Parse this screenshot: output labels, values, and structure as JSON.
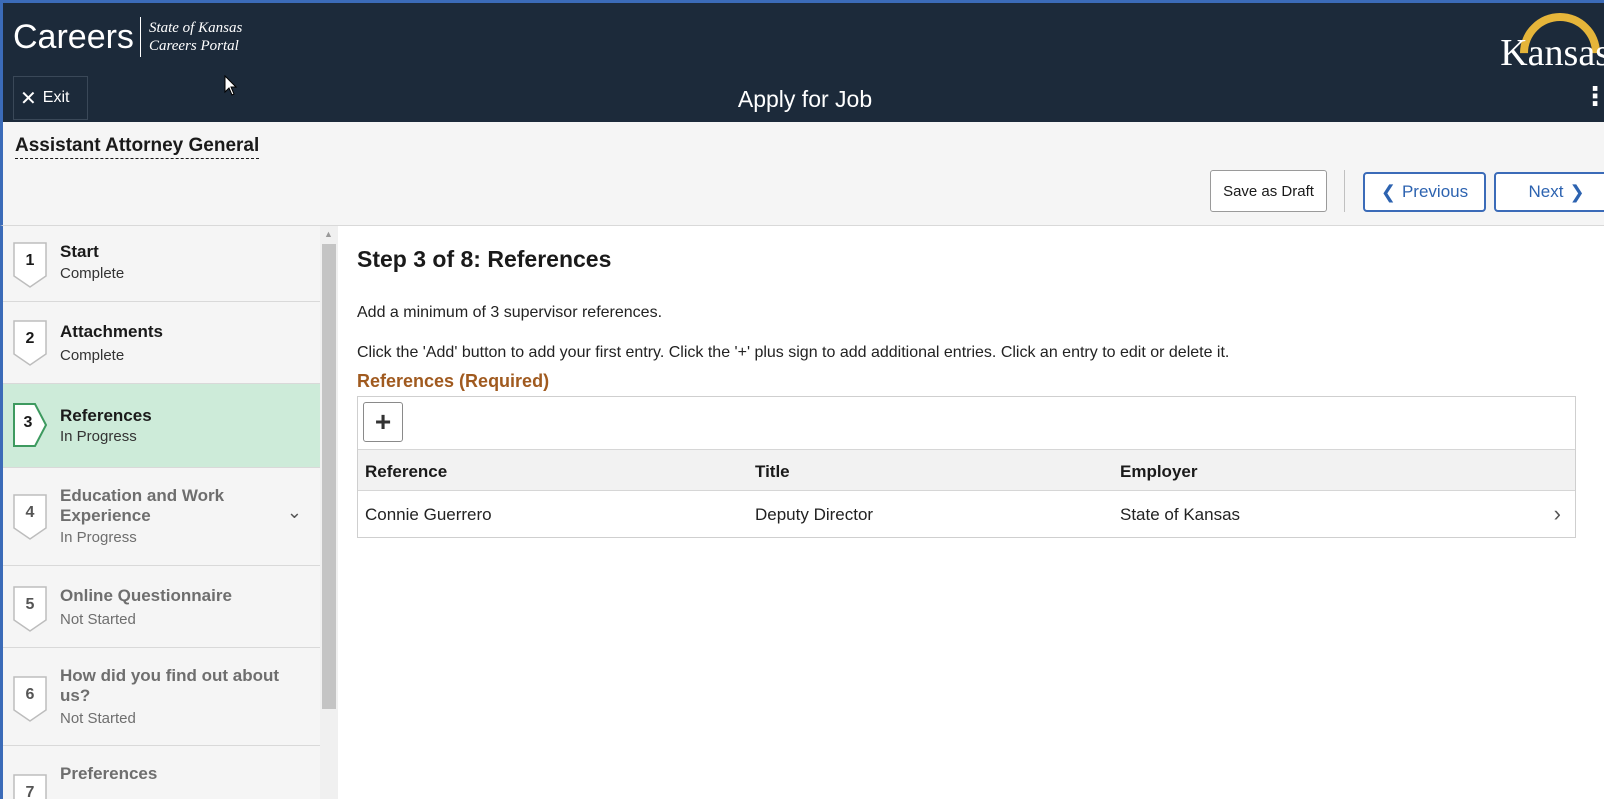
{
  "header": {
    "brand": "Careers",
    "brand_sub_line1": "State of Kansas",
    "brand_sub_line2": "Careers Portal",
    "logo_text": "Kansas",
    "exit_label": "Exit",
    "page_title": "Apply for Job"
  },
  "subheader": {
    "job_title": "Assistant Attorney General",
    "save_draft_label": "Save as Draft",
    "previous_label": "Previous",
    "next_label": "Next"
  },
  "sidebar": {
    "steps": [
      {
        "number": "1",
        "name": "Start",
        "status": "Complete"
      },
      {
        "number": "2",
        "name": "Attachments",
        "status": "Complete"
      },
      {
        "number": "3",
        "name": "References",
        "status": "In Progress"
      },
      {
        "number": "4",
        "name": "Education and Work Experience",
        "status": "In Progress"
      },
      {
        "number": "5",
        "name": "Online Questionnaire",
        "status": "Not Started"
      },
      {
        "number": "6",
        "name": "How did you find out about us?",
        "status": "Not Started"
      },
      {
        "number": "7",
        "name": "Preferences",
        "status": ""
      }
    ]
  },
  "main": {
    "step_title": "Step 3 of 8: References",
    "instruction_1": "Add a minimum of 3 supervisor references.",
    "instruction_2": "Click the 'Add' button to add your first entry. Click the '+' plus sign to add additional entries. Click an entry to edit or delete it.",
    "section_title": "References (Required)",
    "add_symbol": "+",
    "columns": [
      "Reference",
      "Title",
      "Employer"
    ],
    "rows": [
      {
        "reference": "Connie Guerrero",
        "title": "Deputy Director",
        "employer": "State of Kansas"
      }
    ]
  },
  "colors": {
    "header_bg": "#1c2a3a",
    "accent_blue": "#2d63b0",
    "active_step_bg": "#cdebd9",
    "section_title": "#a05a1f"
  }
}
